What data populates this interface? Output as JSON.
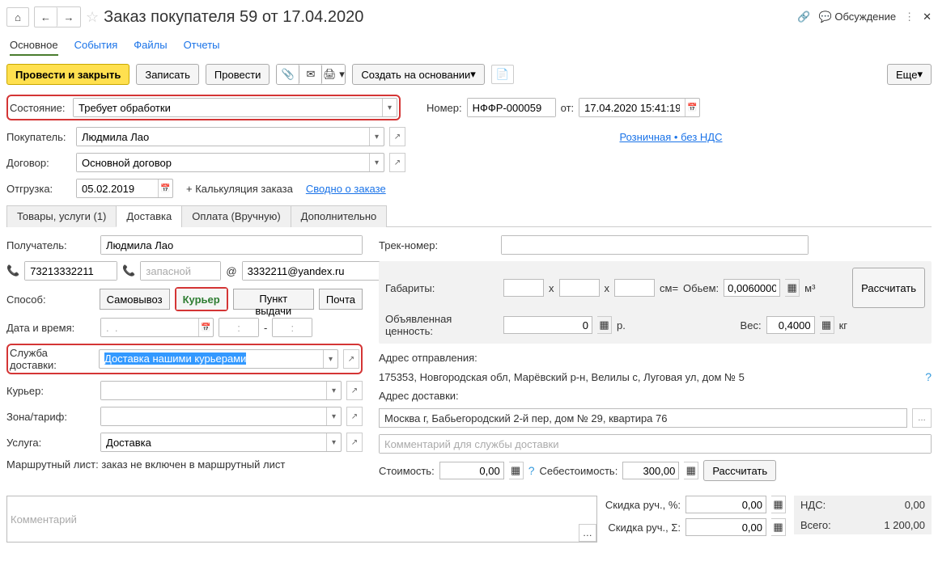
{
  "header": {
    "title": "Заказ покупателя 59 от 17.04.2020",
    "discuss": "Обсуждение"
  },
  "mainTabs": {
    "t1": "Основное",
    "t2": "События",
    "t3": "Файлы",
    "t4": "Отчеты"
  },
  "toolbar": {
    "btn1": "Провести и закрыть",
    "btn2": "Записать",
    "btn3": "Провести",
    "create": "Создать на основании",
    "more": "Еще"
  },
  "state": {
    "label": "Состояние:",
    "value": "Требует обработки"
  },
  "number": {
    "label": "Номер:",
    "value": "НФФР-000059",
    "fromLabel": "от:",
    "date": "17.04.2020 15:41:19"
  },
  "buyer": {
    "label": "Покупатель:",
    "value": "Людмила Лао"
  },
  "headerLink": "Розничная • без НДС",
  "contract": {
    "label": "Договор:",
    "value": "Основной договор"
  },
  "ship": {
    "label": "Отгрузка:",
    "value": "05.02.2019",
    "calc": "+ Калькуляция заказа",
    "summary": "Сводно о заказе"
  },
  "subTabs": {
    "t1": "Товары, услуги (1)",
    "t2": "Доставка",
    "t3": "Оплата (Вручную)",
    "t4": "Дополнительно"
  },
  "left": {
    "recipientLabel": "Получатель:",
    "recipient": "Людмила Лао",
    "phone": "73213332211",
    "phone2ph": "запасной",
    "email": "3332211@yandex.ru",
    "methodLabel": "Способ:",
    "m1": "Самовывоз",
    "m2": "Курьер",
    "m3": "Пункт выдачи",
    "m4": "Почта",
    "dtLabel": "Дата и время:",
    "datePh": ".  .",
    "t1": ":",
    "dash": "-",
    "t2": ":",
    "serviceLabel": "Служба доставки:",
    "service": "Доставка нашими курьерами",
    "courierLabel": "Курьер:",
    "zoneLabel": "Зона/тариф:",
    "uslugeLabel": "Услуга:",
    "usluga": "Доставка",
    "routeText": "Маршрутный лист: заказ не включен в маршрутный лист"
  },
  "right": {
    "trackLabel": "Трек-номер:",
    "dimsLabel": "Габариты:",
    "x": "x",
    "cm": "см=",
    "volLabel": "Обьем:",
    "vol": "0,0060000",
    "m3": "м³",
    "declLabel": "Объявленная ценность:",
    "decl": "0",
    "rub": "р.",
    "weightLabel": "Вес:",
    "weight": "0,4000",
    "kg": "кг",
    "calc": "Рассчитать",
    "addrFromLabel": "Адрес отправления:",
    "addrFrom": "175353, Новгородская обл, Марёвский р-н, Велилы с, Луговая ул, дом № 5",
    "addrToLabel": "Адрес доставки:",
    "addrTo": "Москва г, Бабьегородский 2-й пер, дом № 29, квартира 76",
    "commentPh": "Комментарий для службы доставки",
    "costLabel": "Стоимость:",
    "cost": "0,00",
    "selfLabel": "Себестоимость:",
    "self": "300,00",
    "calc2": "Рассчитать"
  },
  "footer": {
    "commentPh": "Комментарий",
    "discPctLabel": "Скидка руч., %:",
    "discPct": "0,00",
    "discSumLabel": "Скидка руч., Σ:",
    "discSum": "0,00",
    "ndsLabel": "НДС:",
    "nds": "0,00",
    "totalLabel": "Всего:",
    "total": "1 200,00"
  }
}
